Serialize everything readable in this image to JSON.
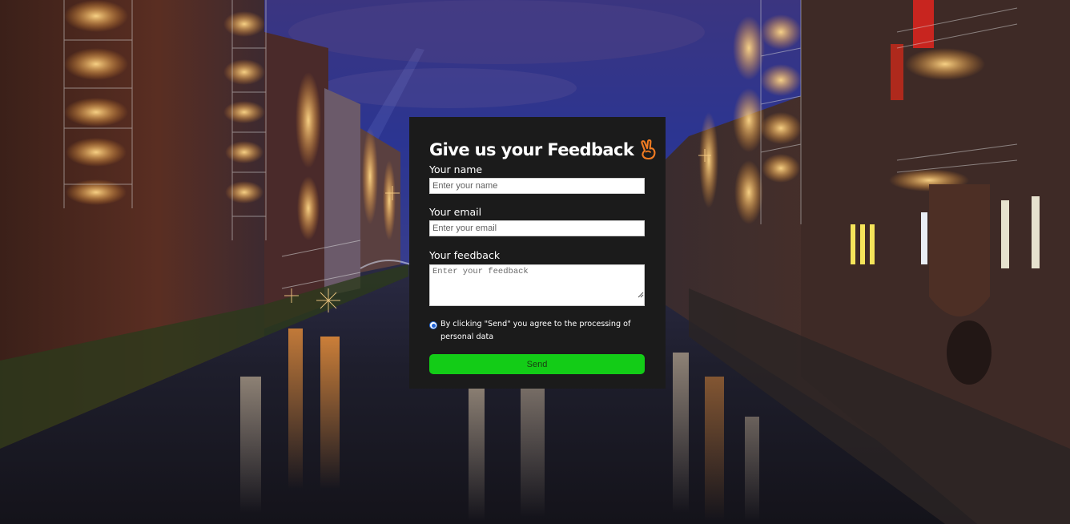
{
  "form": {
    "title": "Give us your Feedback",
    "title_icon": "victory-hand-icon",
    "name_label": "Your name",
    "name_placeholder": "Enter your name",
    "name_value": "",
    "email_label": "Your email",
    "email_placeholder": "Enter your email",
    "email_value": "",
    "feedback_label": "Your feedback",
    "feedback_placeholder": "Enter your feedback",
    "feedback_value": "",
    "consent_text": "By clicking \"Send\" you agree to the processing of personal data",
    "consent_checked": true,
    "send_label": "Send"
  },
  "colors": {
    "card_background": "#1b1b1b",
    "send_button": "#13cc17",
    "icon_accent": "#f07b22",
    "radio_accent": "#1e63d8"
  },
  "background": {
    "icon": "night-canal-photo"
  }
}
